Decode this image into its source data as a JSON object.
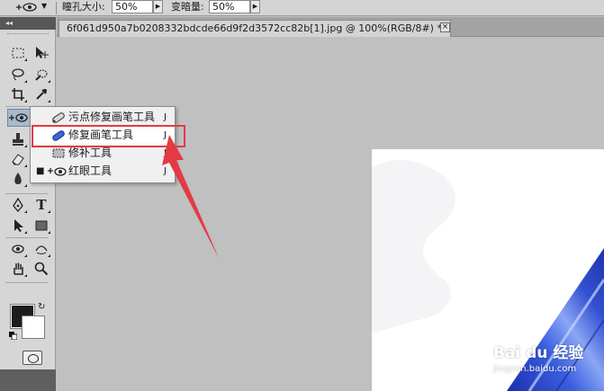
{
  "options_bar": {
    "pupil_size_label": "瞳孔大小:",
    "pupil_size_value": "50%",
    "darken_label": "变暗量:",
    "darken_value": "50%"
  },
  "document": {
    "tab_title": "6f061d950a7b0208332bdcde66d9f2d3572cc82b[1].jpg @ 100%(RGB/8#) *",
    "close_glyph": "×"
  },
  "toolbox": {
    "header": "◂◂"
  },
  "flyout": {
    "items": [
      {
        "label": "污点修复画笔工具",
        "shortcut": "J",
        "icon": "spot-healing-brush-icon",
        "current": false,
        "selected": false
      },
      {
        "label": "修复画笔工具",
        "shortcut": "J",
        "icon": "healing-brush-icon",
        "current": false,
        "selected": true
      },
      {
        "label": "修补工具",
        "shortcut": "J",
        "icon": "patch-icon",
        "current": false,
        "selected": false
      },
      {
        "label": "红眼工具",
        "shortcut": "J",
        "icon": "red-eye-icon",
        "current": true,
        "selected": false
      }
    ],
    "bullet": "■"
  },
  "colors": {
    "highlight": "#e43a44",
    "foreground": "#1d1d1d",
    "background": "#ffffff"
  },
  "watermark": {
    "main": "Bai du 经验",
    "sub": "jingyan.baidu.com"
  }
}
